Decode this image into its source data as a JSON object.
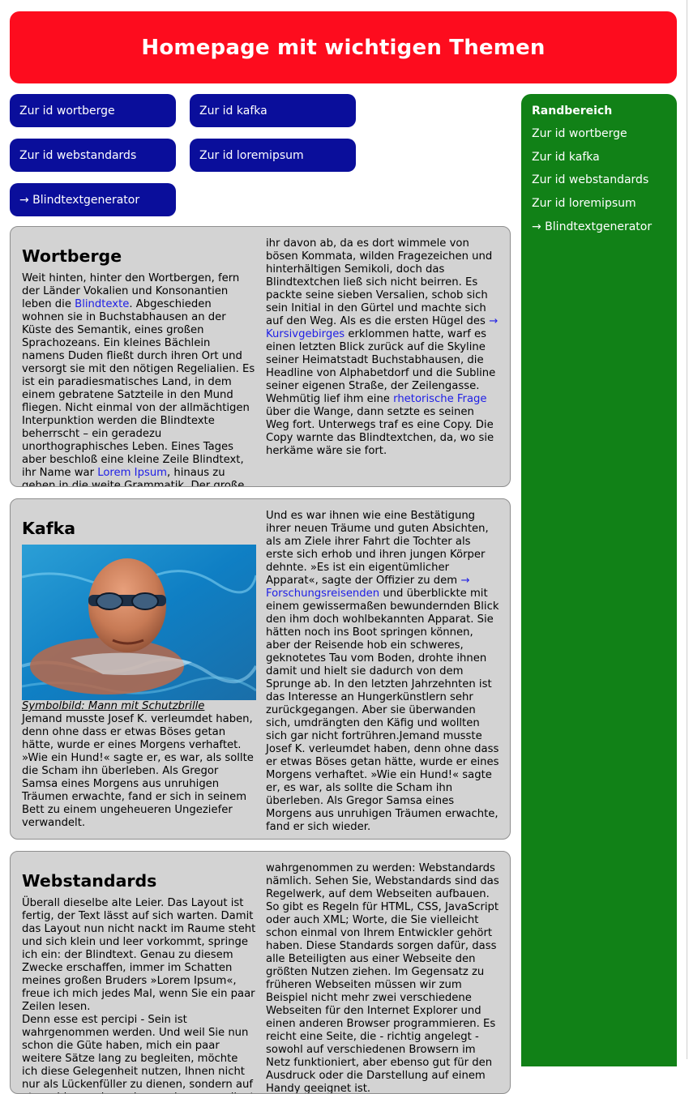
{
  "header": {
    "title": "Homepage mit wichtigen Themen"
  },
  "nav": {
    "wortberge": "Zur id wortberge",
    "kafka": "Zur id kafka",
    "webstandards": "Zur id webstandards",
    "loremipsum": "Zur id loremipsum",
    "generator": "→ Blindtextgenerator"
  },
  "sidebar": {
    "title": "Randbereich",
    "items": [
      "Zur id wortberge",
      "Zur id kafka",
      "Zur id webstandards",
      "Zur id loremipsum",
      "→ Blindtextgenerator"
    ]
  },
  "wortberge": {
    "title": "Wortberge",
    "left_1": "Weit hinten, hinter den Wortbergen, fern der Länder Vokalien und Konsonantien leben die ",
    "link_1": "Blindtexte",
    "left_2": ". Abgeschieden wohnen sie in Buchstabhausen an der Küste des Semantik, eines großen Sprachozeans. Ein kleines Bächlein namens Duden fließt durch ihren Ort und versorgt sie mit den nötigen Regelialien. Es ist ein paradiesmatisches Land, in dem einem gebratene Satzteile in den Mund fliegen. Nicht einmal von der allmächtigen Interpunktion werden die Blindtexte beherrscht – ein geradezu unorthographisches Leben. Eines Tages aber beschloß eine kleine Zeile Blindtext, ihr Name war ",
    "link_2": "Lorem Ipsum",
    "left_3": ", hinaus zu gehen in die weite Grammatik. Der große Oxmox riet",
    "right_1": "ihr davon ab, da es dort wimmele von bösen Kommata, wilden Fragezeichen und hinterhältigen Semikoli, doch das Blindtextchen ließ sich nicht beirren. Es packte seine sieben Versalien, schob sich sein Initial in den Gürtel und machte sich auf den Weg. Als es die ersten Hügel des ",
    "link_3": "→ Kursivgebirges",
    "right_2": " erklommen hatte, warf es einen letzten Blick zurück auf die Skyline seiner Heimatstadt Buchstabhausen, die Headline von Alphabetdorf und die Subline seiner eigenen Straße, der Zeilengasse. Wehmütig lief ihm eine ",
    "link_4": "rhetorische Frage",
    "right_3": " über die Wange, dann setzte es seinen Weg fort. Unterwegs traf es eine Copy. Die Copy warnte das Blindtextchen, da, wo sie herkäme wäre sie fort."
  },
  "kafka": {
    "title": "Kafka",
    "caption": "Symbolbild: Mann mit Schutzbrille",
    "left_1": "Jemand musste Josef K. verleumdet haben, denn ohne dass er etwas Böses getan hätte, wurde er eines Morgens verhaftet. »Wie ein Hund!« sagte er, es war, als sollte die Scham ihn überleben. Als Gregor Samsa eines Morgens aus unruhigen Träumen erwachte, fand er sich in seinem Bett zu einem ungeheueren Ungeziefer verwandelt.",
    "right_1": "Und es war ihnen wie eine Bestätigung ihrer neuen Träume und guten Absichten, als am Ziele ihrer Fahrt die Tochter als erste sich erhob und ihren jungen Körper dehnte. »Es ist ein eigentümlicher Apparat«, sagte der Offizier zu dem ",
    "link_1": "→ Forschungsreisenden",
    "right_2": " und überblickte mit einem gewissermaßen bewundernden Blick den ihm doch wohlbekannten Apparat. Sie hätten noch ins Boot springen können, aber der Reisende hob ein schweres, geknotetes Tau vom Boden, drohte ihnen damit und hielt sie dadurch von dem Sprunge ab. In den letzten Jahrzehnten ist das Interesse an Hungerkünstlern sehr zurückgegangen. Aber sie überwanden sich, umdrängten den Käfig und wollten sich gar nicht fortrühren.Jemand musste Josef K. verleumdet haben, denn ohne dass er etwas Böses getan hätte, wurde er eines Morgens verhaftet. »Wie ein Hund!« sagte er, es war, als sollte die Scham ihn überleben. Als Gregor Samsa eines Morgens aus unruhigen Träumen erwachte, fand er sich wieder."
  },
  "webstandards": {
    "title": "Webstandards",
    "left_1": "Überall dieselbe alte Leier. Das Layout ist fertig, der Text lässt auf sich warten. Damit das Layout nun nicht nackt im Raume steht und sich klein und leer vorkommt, springe ich ein: der Blindtext. Genau zu diesem Zwecke erschaffen, immer im Schatten meines großen Bruders »Lorem Ipsum«, freue ich mich jedes Mal, wenn Sie ein paar Zeilen lesen.",
    "left_2": "Denn esse est percipi - Sein ist wahrgenommen werden. Und weil Sie nun schon die Güte haben, mich ein paar weitere Sätze lang zu begleiten, möchte ich diese Gelegenheit nutzen, Ihnen nicht nur als Lückenfüller zu dienen, sondern auf etwas hinzuweisen, das es ebenso verdient",
    "right_1": "wahrgenommen zu werden: Webstandards nämlich. Sehen Sie, Webstandards sind das Regelwerk, auf dem Webseiten aufbauen. So gibt es Regeln für HTML, CSS, JavaScript oder auch XML; Worte, die Sie vielleicht schon einmal von Ihrem Entwickler gehört haben. Diese Standards sorgen dafür, dass alle Beteiligten aus einer Webseite den größten Nutzen ziehen. Im Gegensatz zu früheren Webseiten müssen wir zum Beispiel nicht mehr zwei verschiedene Webseiten für den Internet Explorer und einen anderen Browser programmieren. Es reicht eine Seite, die - richtig angelegt - sowohl auf verschiedenen Browsern im Netz funktioniert, aber ebenso gut für den Ausdruck oder die Darstellung auf einem Handy geeignet ist."
  }
}
